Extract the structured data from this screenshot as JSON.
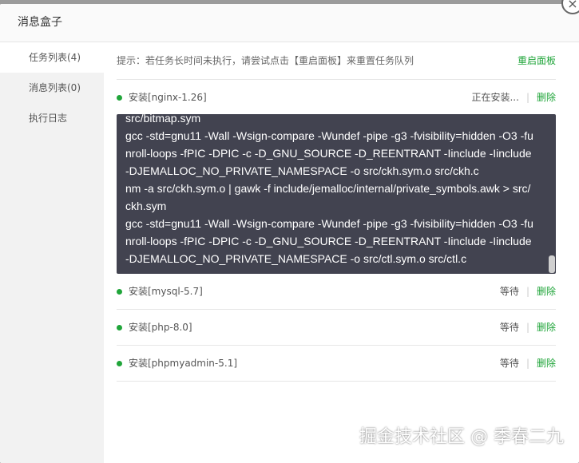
{
  "dialog": {
    "title": "消息盒子",
    "close_symbol": "×"
  },
  "sidebar": {
    "items": [
      {
        "label": "任务列表(4)"
      },
      {
        "label": "消息列表(0)"
      },
      {
        "label": "执行日志"
      }
    ]
  },
  "tip": {
    "text": "提示：若任务长时间未执行，请尝试点击【重启面板】来重置任务队列",
    "reset_label": "重启面板"
  },
  "tasks": [
    {
      "name": "安装[nginx-1.26]",
      "status": "正在安装...",
      "delete_label": "删除"
    },
    {
      "name": "安装[mysql-5.7]",
      "status": "等待",
      "delete_label": "删除"
    },
    {
      "name": "安装[php-8.0]",
      "status": "等待",
      "delete_label": "删除"
    },
    {
      "name": "安装[phpmyadmin-5.1]",
      "status": "等待",
      "delete_label": "删除"
    }
  ],
  "log_lines": [
    "src/bitmap.sym",
    "gcc -std=gnu11 -Wall -Wsign-compare -Wundef -pipe -g3 -fvisibility=hidden -O3 -funroll-loops -fPIC -DPIC -c -D_GNU_SOURCE -D_REENTRANT -Iinclude -Iinclude -DJEMALLOC_NO_PRIVATE_NAMESPACE -o src/ckh.sym.o src/ckh.c",
    "nm -a src/ckh.sym.o | gawk -f include/jemalloc/internal/private_symbols.awk > src/ckh.sym",
    "gcc -std=gnu11 -Wall -Wsign-compare -Wundef -pipe -g3 -fvisibility=hidden -O3 -funroll-loops -fPIC -DPIC -c -D_GNU_SOURCE -D_REENTRANT -Iinclude -Iinclude -DJEMALLOC_NO_PRIVATE_NAMESPACE -o src/ctl.sym.o src/ctl.c"
  ],
  "watermark": "掘金技术社区 @ 季春二九",
  "colors": {
    "accent": "#20a53a",
    "log_bg": "#424350"
  }
}
